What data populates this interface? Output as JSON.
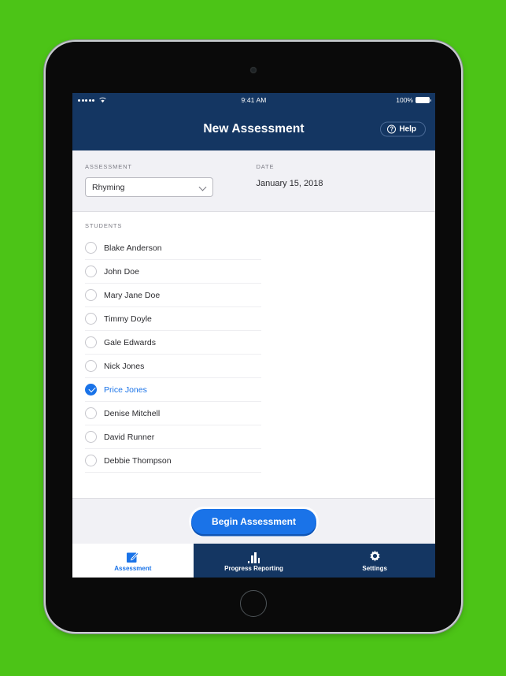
{
  "theme": {
    "background_green": "#4cc417",
    "nav_navy": "#143662",
    "accent_blue": "#1a73e8",
    "panel_gray": "#f1f1f5"
  },
  "status_bar": {
    "signal_icon": "signal-dots-icon",
    "wifi_icon": "wifi-icon",
    "time": "9:41 AM",
    "battery_percent": "100%",
    "battery_icon": "battery-full-icon"
  },
  "nav_bar": {
    "title": "New Assessment",
    "help_label": "Help",
    "help_icon": "question-circle-icon"
  },
  "meta": {
    "assessment_label": "ASSESSMENT",
    "assessment_value": "Rhyming",
    "assessment_chevron_icon": "chevron-down-icon",
    "date_label": "DATE",
    "date_value": "January 15, 2018"
  },
  "students": {
    "label": "STUDENTS",
    "items": [
      {
        "name": "Blake Anderson",
        "selected": false
      },
      {
        "name": "John Doe",
        "selected": false
      },
      {
        "name": "Mary Jane Doe",
        "selected": false
      },
      {
        "name": "Timmy Doyle",
        "selected": false
      },
      {
        "name": "Gale Edwards",
        "selected": false
      },
      {
        "name": "Nick Jones",
        "selected": false
      },
      {
        "name": "Price Jones",
        "selected": true
      },
      {
        "name": "Denise Mitchell",
        "selected": false
      },
      {
        "name": "David Runner",
        "selected": false
      },
      {
        "name": "Debbie Thompson",
        "selected": false
      }
    ]
  },
  "footer": {
    "begin_label": "Begin Assessment"
  },
  "tab_bar": {
    "tabs": [
      {
        "label": "Assessment",
        "icon": "pencil-square-icon",
        "active": true
      },
      {
        "label": "Progress Reporting",
        "icon": "bar-chart-icon",
        "active": false
      },
      {
        "label": "Settings",
        "icon": "gear-icon",
        "active": false
      }
    ]
  }
}
